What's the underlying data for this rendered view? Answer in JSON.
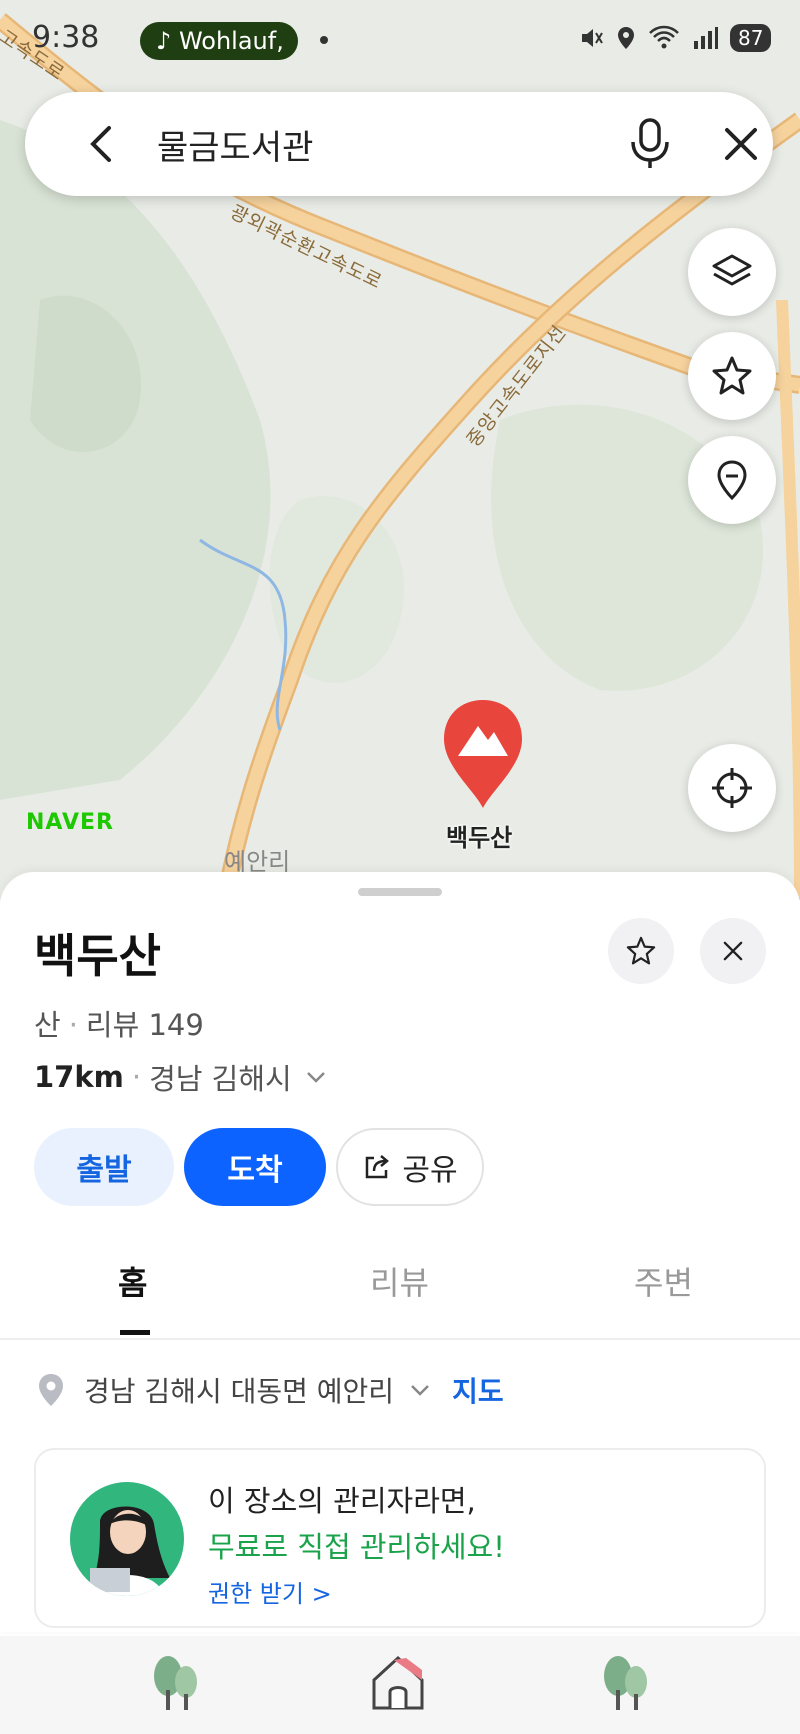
{
  "status_bar": {
    "time": "9:38",
    "music": "Wohlauf,",
    "battery": "87"
  },
  "search": {
    "query": "물금도서관",
    "icons": [
      "back-arrow-icon",
      "microphone-icon",
      "close-icon"
    ]
  },
  "map": {
    "road_labels": [
      "광외곽순환고속도로",
      "중앙고속도로지선",
      "고속도로"
    ],
    "place_labels": [
      "예안리"
    ],
    "logo": "NAVER",
    "pin_label": "백두산",
    "colors": {
      "road": "#f4cc90",
      "forest": "#d6e2d2",
      "pin": "#e8453c"
    }
  },
  "place": {
    "title": "백두산",
    "category": "산",
    "reviews": "리뷰 149",
    "distance": "17km",
    "region": "경남 김해시",
    "actions": {
      "depart": "출발",
      "arrive": "도착",
      "share": "공유"
    },
    "tabs": [
      "홈",
      "리뷰",
      "주변"
    ],
    "address": "경남 김해시 대동면 예안리",
    "map_link": "지도",
    "owner_card": {
      "line1": "이 장소의 관리자라면,",
      "line2": "무료로 직접 관리하세요!",
      "link": "권한 받기 >"
    }
  }
}
